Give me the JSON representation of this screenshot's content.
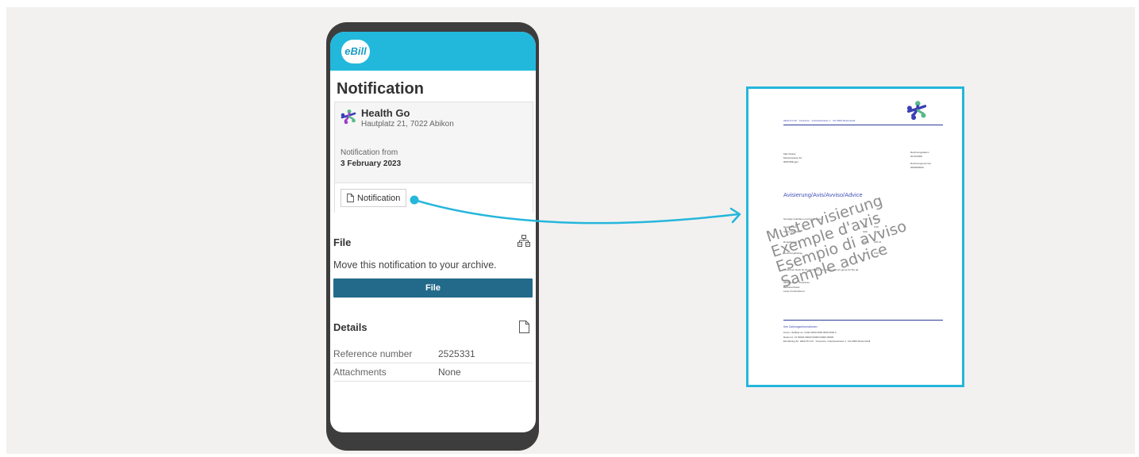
{
  "app": {
    "logo_text": "eBill",
    "page_title": "Notification"
  },
  "sender": {
    "name": "Health Go",
    "address": "Hautplatz 21, 7022 Abikon",
    "notification_from_label": "Notification from",
    "date": "3 February 2023",
    "notification_button": "Notification"
  },
  "file_section": {
    "title": "File",
    "description": "Move this notification to your archive.",
    "button": "File"
  },
  "details": {
    "title": "Details",
    "rows": [
      {
        "label": "Reference number",
        "value": "2525331"
      },
      {
        "label": "Attachments",
        "value": "None"
      }
    ]
  },
  "document": {
    "header_line": "HEALTH GO · Insurance · Industriestrasse 1 · CH 9000 Musterstadt",
    "recipient": [
      "Max Muster",
      "Musterstrasse 42",
      "9000 Billingen"
    ],
    "meta": [
      "Rechnungsdatum",
      "00.00.0000",
      "Rechnungsnummer",
      "0000000000"
    ],
    "heading": "Avisierung/Avis/Avviso/Advice",
    "lines": [
      {
        "label": "Sonstige Gutlufaen und Forderungen",
        "cur": "CHF",
        "amt": "44.80"
      },
      {
        "label": "Depotstrusen",
        "cur": "CHF",
        "amt": "0.00"
      },
      {
        "label": "Storno gutschrift",
        "cur": "CHF",
        "amt": "20.15"
      },
      {
        "label": "Rungsbetrag",
        "cur": "CHF",
        "amt": "125.13"
      },
      {
        "label": "Rechnungsbetrag",
        "cur": "CHF",
        "amt": "0.00"
      }
    ],
    "note": "Herzlichen Dank für Ihr Vertrauen. Bei Fragen sind wir gerne für Sie da.",
    "signature": [
      "HEALTH GO · Insurance",
      "Barbara Muster",
      "Leiter Kundendienst"
    ],
    "footer_title": "Ihre Zahlungsinformationen",
    "footer_lines": [
      "Konto / Zahlbar an:   CH94 0000 0000 0000 0000 0",
      "Referenz:   21 00000 00000 00000 00000 00000",
      "Einzahlung für:   HEALTH GO · Insurance, Industriestrasse 1, CH-9000 Musterstadt"
    ],
    "watermark": [
      "Mustervisierung",
      "Exemple d'avis",
      "Esempio di avviso",
      "Sample advice"
    ]
  },
  "colors": {
    "accent": "#22b8dc",
    "button": "#236a8a",
    "phone_frame": "#3d3d3d",
    "doc_text": "#3b4bb0"
  },
  "icons": [
    "document-icon",
    "archive-icon",
    "details-icon",
    "health-go-logo"
  ]
}
